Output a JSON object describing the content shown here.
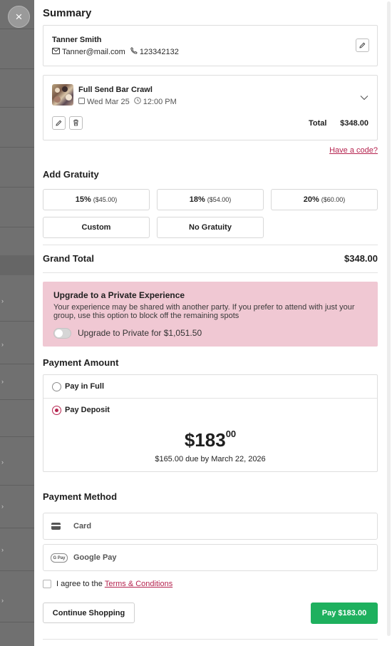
{
  "close_glyph": "×",
  "summary": {
    "title": "Summary",
    "customer": {
      "name": "Tanner Smith",
      "email": "Tanner@mail.com",
      "phone": "123342132"
    },
    "booking": {
      "title": "Full Send Bar Crawl",
      "date": "Wed Mar 25",
      "time": "12:00 PM",
      "total_label": "Total",
      "total_value": "$348.00"
    },
    "code_link": "Have a code?"
  },
  "gratuity": {
    "title": "Add Gratuity",
    "options": [
      {
        "label": "15%",
        "amount": "($45.00)"
      },
      {
        "label": "18%",
        "amount": "($54.00)"
      },
      {
        "label": "20%",
        "amount": "($60.00)"
      },
      {
        "label": "Custom",
        "amount": ""
      },
      {
        "label": "No Gratuity",
        "amount": ""
      }
    ]
  },
  "grand_total": {
    "label": "Grand Total",
    "value": "$348.00"
  },
  "upgrade": {
    "title": "Upgrade to a Private Experience",
    "text": "Your experience may be shared with another party. If you prefer to attend with just your group, use this option to block off the remaining spots",
    "toggle_label": "Upgrade to Private for $1,051.50",
    "enabled": false
  },
  "payment_amount": {
    "title": "Payment Amount",
    "options": [
      {
        "label": "Pay in Full",
        "selected": false
      },
      {
        "label": "Pay Deposit",
        "selected": true
      }
    ],
    "deposit_dollars": "$183",
    "deposit_cents": "00",
    "due_text": "$165.00 due by March 22, 2026"
  },
  "payment_method": {
    "title": "Payment Method",
    "options": [
      {
        "label": "Card",
        "icon": "credit-card-icon"
      },
      {
        "label": "Google Pay",
        "icon": "google-pay-icon",
        "icon_text": "G Pay"
      }
    ]
  },
  "agreement": {
    "prefix": "I agree to the",
    "link": "Terms & Conditions"
  },
  "actions": {
    "continue_label": "Continue Shopping",
    "pay_label": "Pay $183.00"
  },
  "colors": {
    "accent": "#b5244f",
    "pay_button": "#1eb05e",
    "upgrade_bg": "#f0c8d3"
  }
}
